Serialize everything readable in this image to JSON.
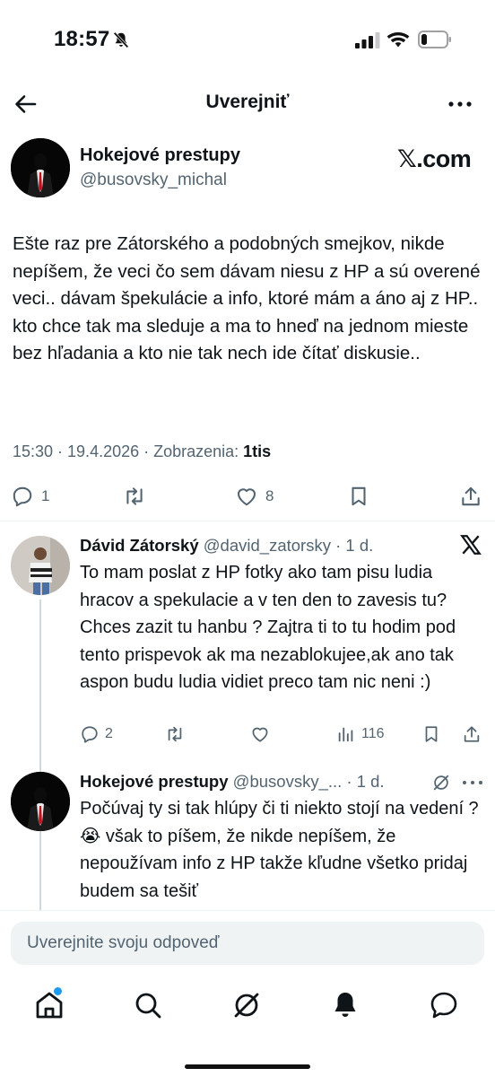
{
  "status_bar": {
    "time": "18:57",
    "icons": [
      "bell-slash-icon",
      "signal-icon",
      "wifi-icon",
      "battery-icon"
    ]
  },
  "header": {
    "title": "Uverejniť",
    "back_icon": "arrow-left-icon",
    "more_icon": "ellipsis-icon"
  },
  "main_post": {
    "author_name": "Hokejové prestupy",
    "author_handle": "@busovsky_michal",
    "brand_text": "𝕏.com",
    "text": "Ešte raz pre Zátorského a podobných smejkov, nikde nepíšem, že veci čo sem dávam niesu z HP a sú overené veci.. dávam špekulácie a info, ktoré mám a áno aj z HP.. kto chce tak ma sleduje a ma to hneď na jednom mieste bez hľadania a kto nie tak nech ide čítať diskusie..",
    "meta_prefix": "15:30 · 19.4.2026 · Zobrazenia: ",
    "views": "1tis",
    "replies": "1",
    "reposts": "",
    "likes": "8"
  },
  "replies": [
    {
      "author_name": "Dávid Zátorský",
      "meta": "@david_zatorsky · 1 d.",
      "text": "To mam poslat z HP fotky ako tam pisu ludia hracov a spekulacie a v ten den to zavesis tu? Chces zazit tu hanbu ? Zajtra ti to tu hodim pod tento prispevok ak ma nezablokujee,ak ano tak aspon budu ludia vidiet preco tam nic neni :)",
      "replies": "2",
      "reposts": "",
      "likes": "",
      "views": "116",
      "badge_icon": "x-logo-icon"
    },
    {
      "author_name": "Hokejové prestupy",
      "meta": "@busovsky_... · 1 d.",
      "text": "Počúvaj ty si tak hlúpy či ti niekto stojí na vedení ? 😭 však to píšem, že nikde nepíšem, že nepoužívam info z HP takže kľudne všetko pridaj budem sa tešiť",
      "badge_icon": "grok-icon",
      "more_icon": "ellipsis-icon"
    }
  ],
  "composer": {
    "placeholder": "Uverejnite svoju odpoveď"
  },
  "bottom_nav": [
    "home-icon",
    "search-icon",
    "grok-icon",
    "notifications-icon",
    "messages-icon"
  ],
  "colors": {
    "text": "#0f1419",
    "secondary": "#536471",
    "accent": "#1d9bf0",
    "divider": "#eff3f4"
  }
}
